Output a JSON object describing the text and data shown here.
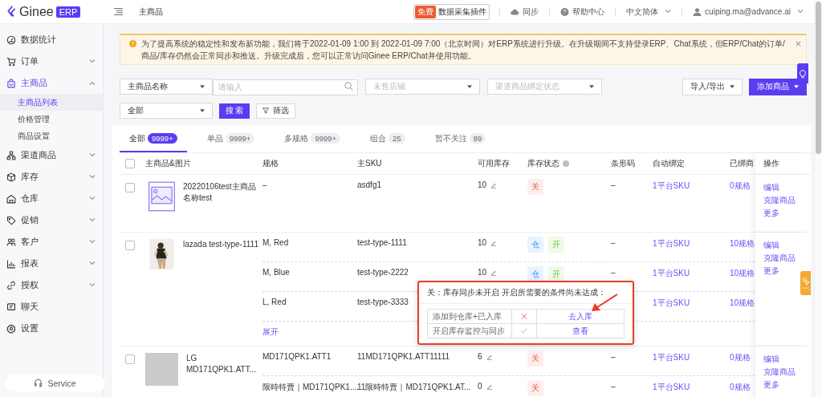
{
  "topbar": {
    "logo_text": "Ginee",
    "logo_badge": "ERP",
    "breadcrumb": "主商品",
    "plugin": {
      "badge": "免费",
      "label": "数据采集插件"
    },
    "links": [
      {
        "kind": "sync",
        "label": "同步",
        "dropdown": false
      },
      {
        "kind": "help",
        "label": "帮助中心",
        "dropdown": false
      },
      {
        "kind": "language",
        "label": "中文简体",
        "dropdown": true
      },
      {
        "kind": "user",
        "label": "cuiping.ma@advance.ai",
        "dropdown": true
      }
    ]
  },
  "sidebar": {
    "items": [
      {
        "label": "数据统计",
        "selected": false
      },
      {
        "label": "订单",
        "selected": false,
        "expanded": false
      },
      {
        "label": "主商品",
        "selected": true,
        "expanded": true,
        "children": [
          {
            "label": "主商品列表",
            "selected": true
          },
          {
            "label": "价格管理",
            "selected": false
          },
          {
            "label": "商品设置",
            "selected": false
          }
        ]
      },
      {
        "label": "渠道商品",
        "selected": false,
        "expanded": false
      },
      {
        "label": "库存",
        "selected": false,
        "expanded": false
      },
      {
        "label": "仓库",
        "selected": false,
        "expanded": false
      },
      {
        "label": "促销",
        "selected": false,
        "expanded": false
      },
      {
        "label": "客户",
        "selected": false,
        "expanded": false
      },
      {
        "label": "报表",
        "selected": false,
        "expanded": false
      },
      {
        "label": "授权",
        "selected": false,
        "expanded": false
      },
      {
        "label": "聊天",
        "selected": false
      },
      {
        "label": "设置",
        "selected": false
      }
    ],
    "service": "Service"
  },
  "notice": {
    "text": "为了提高系统的稳定性和发布新功能，我们将于2022-01-09 1:00 到 2022-01-09 7:00（北京时间）对ERP系统进行升级。在升级期间不支持登录ERP、Chat系统，但ERP/Chat的订单/商品/库存仍然会正常同步和推送。升级完成后，您可以正常访问Ginee ERP/Chat并使用功能。"
  },
  "filters": {
    "row1": [
      {
        "kind": "select",
        "value": "主商品名称"
      },
      {
        "kind": "search",
        "placeholder": "请输入"
      },
      {
        "kind": "select",
        "placeholder": "未售店铺"
      },
      {
        "kind": "select",
        "placeholder": "渠道商品绑定状态"
      }
    ],
    "actions": [
      {
        "label": "导入/导出",
        "primary": false
      },
      {
        "label": "添加商品",
        "primary": true
      }
    ],
    "row2": [
      {
        "kind": "select",
        "value": "全部"
      },
      {
        "kind": "button",
        "label": "搜 索"
      },
      {
        "kind": "filter",
        "label": "筛选"
      }
    ]
  },
  "tabs": [
    {
      "label": "全部",
      "count": "9999+",
      "selected": true
    },
    {
      "label": "单品",
      "count": "9999+",
      "selected": false
    },
    {
      "label": "多规格",
      "count": "9999+",
      "selected": false
    },
    {
      "label": "组合",
      "count": "25",
      "selected": false
    },
    {
      "label": "暂不关注",
      "count": "89",
      "selected": false
    }
  ],
  "table": {
    "checked": false,
    "columns": [
      "主商品&图片",
      "规格",
      "主SKU",
      "可用库存",
      "库存状态",
      "条形码",
      "自动绑定",
      "已绑商",
      "操作"
    ],
    "rows": [
      {
        "checked": false,
        "image": {
          "kind": "icon"
        },
        "name": "20220106test主商品名称test",
        "actions": [
          "编辑",
          "克隆商品",
          "更多"
        ],
        "variants": [
          {
            "spec": "–",
            "sku": "asdfg1",
            "stock": "10",
            "status": [
              {
                "kind": "off",
                "label": "关"
              }
            ],
            "barcode": "–",
            "auto_bind": "1平台SKU",
            "bound": "0规格"
          }
        ]
      },
      {
        "checked": false,
        "image": {
          "kind": "picture"
        },
        "name": "lazada test-type-1111",
        "expand_label": "展开",
        "actions": [
          "编辑",
          "克隆商品",
          "更多"
        ],
        "variants": [
          {
            "spec": "M, Red",
            "sku": "test-type-1111",
            "stock": "10",
            "status": [
              {
                "kind": "warehouse",
                "label": "仓"
              },
              {
                "kind": "on",
                "label": "开"
              }
            ],
            "barcode": "–",
            "auto_bind": "1平台SKU",
            "bound": "10规格"
          },
          {
            "spec": "M, Blue",
            "sku": "test-type-2222",
            "stock": "10",
            "status": [
              {
                "kind": "warehouse",
                "label": "仓"
              },
              {
                "kind": "on",
                "label": "开"
              }
            ],
            "barcode": "–",
            "auto_bind": "1平台SKU",
            "bound": "10规格"
          },
          {
            "spec": "L, Red",
            "sku": "test-type-3333",
            "auto_bind": "1平台SKU",
            "bound": "10规格"
          }
        ]
      },
      {
        "checked": false,
        "image": {
          "kind": "blank"
        },
        "name": "LG MD171QPK1.ATT...",
        "actions": [
          "编辑",
          "克隆商品",
          "更多"
        ],
        "variants": [
          {
            "spec": "MD171QPK1.ATT1",
            "sku": "11MD171QPK1.ATT11111",
            "stock": "6",
            "status": [
              {
                "kind": "off",
                "label": "关"
              }
            ],
            "barcode": "–",
            "auto_bind": "1平台SKU",
            "bound": "0规格"
          },
          {
            "spec": "限時特賣｜MD171QPK1....",
            "sku": "11限時特賣｜MD171QPK1.AT...",
            "stock": "0",
            "status": [
              {
                "kind": "off",
                "label": "关"
              }
            ],
            "barcode": "–",
            "auto_bind": "1平台SKU",
            "bound": "0规格"
          }
        ]
      }
    ]
  },
  "popup": {
    "title": "关：库存同步未开启 开启所需要的条件尚未达成：",
    "conditions": [
      {
        "label": "添加到仓库+已入库",
        "met": false,
        "action": "去入库"
      },
      {
        "label": "开启库存监控与同步",
        "met": true,
        "action": "查看"
      }
    ]
  }
}
